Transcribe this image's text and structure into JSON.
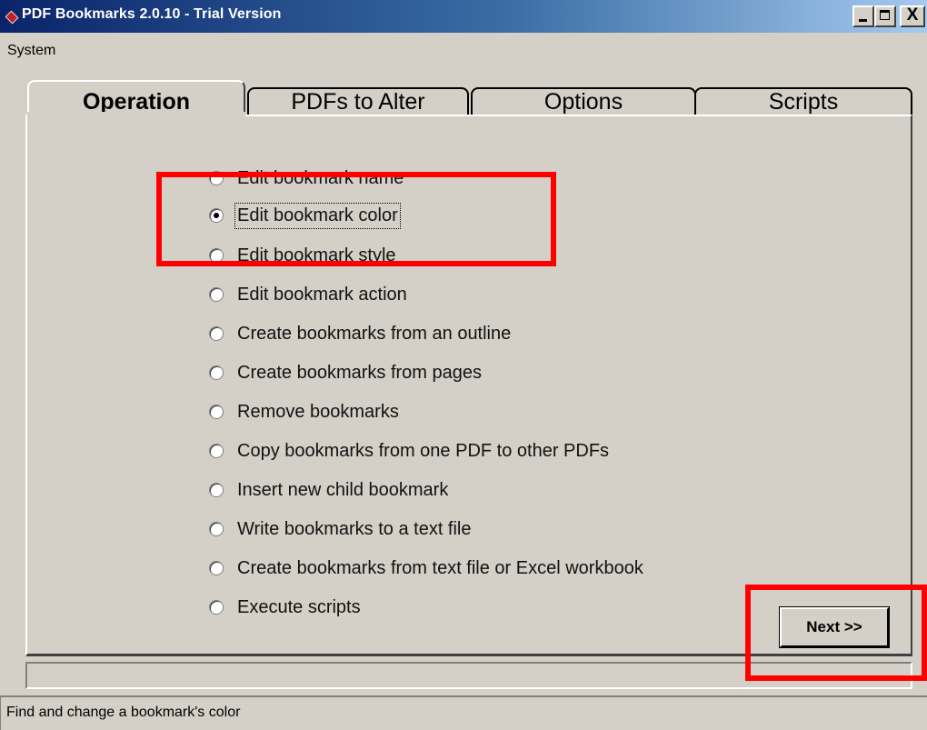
{
  "window": {
    "title": "PDF Bookmarks 2.0.10 - Trial Version",
    "close_glyph": "X"
  },
  "menu": [
    "System"
  ],
  "tabs": [
    "Operation",
    "PDFs to Alter",
    "Options",
    "Scripts"
  ],
  "active_tab": "Operation",
  "operations": [
    {
      "label": "Edit bookmark name",
      "checked": false
    },
    {
      "label": "Edit bookmark color",
      "checked": true
    },
    {
      "label": "Edit bookmark style",
      "checked": false
    },
    {
      "label": "Edit bookmark action",
      "checked": false
    },
    {
      "label": "Create bookmarks from an outline",
      "checked": false
    },
    {
      "label": "Create bookmarks from pages",
      "checked": false
    },
    {
      "label": "Remove bookmarks",
      "checked": false
    },
    {
      "label": "Copy bookmarks from one PDF to other PDFs",
      "checked": false
    },
    {
      "label": "Insert new child bookmark",
      "checked": false
    },
    {
      "label": "Write bookmarks to a text file",
      "checked": false
    },
    {
      "label": "Create bookmarks from text file or Excel workbook",
      "checked": false
    },
    {
      "label": "Execute scripts",
      "checked": false
    }
  ],
  "next_button": "Next >>",
  "status": "Find and change a bookmark's color",
  "colors": {
    "titlebar_start": "#0a246a",
    "titlebar_end": "#a6caf0",
    "face": "#d4d0c8",
    "highlight": "#ff0000"
  }
}
